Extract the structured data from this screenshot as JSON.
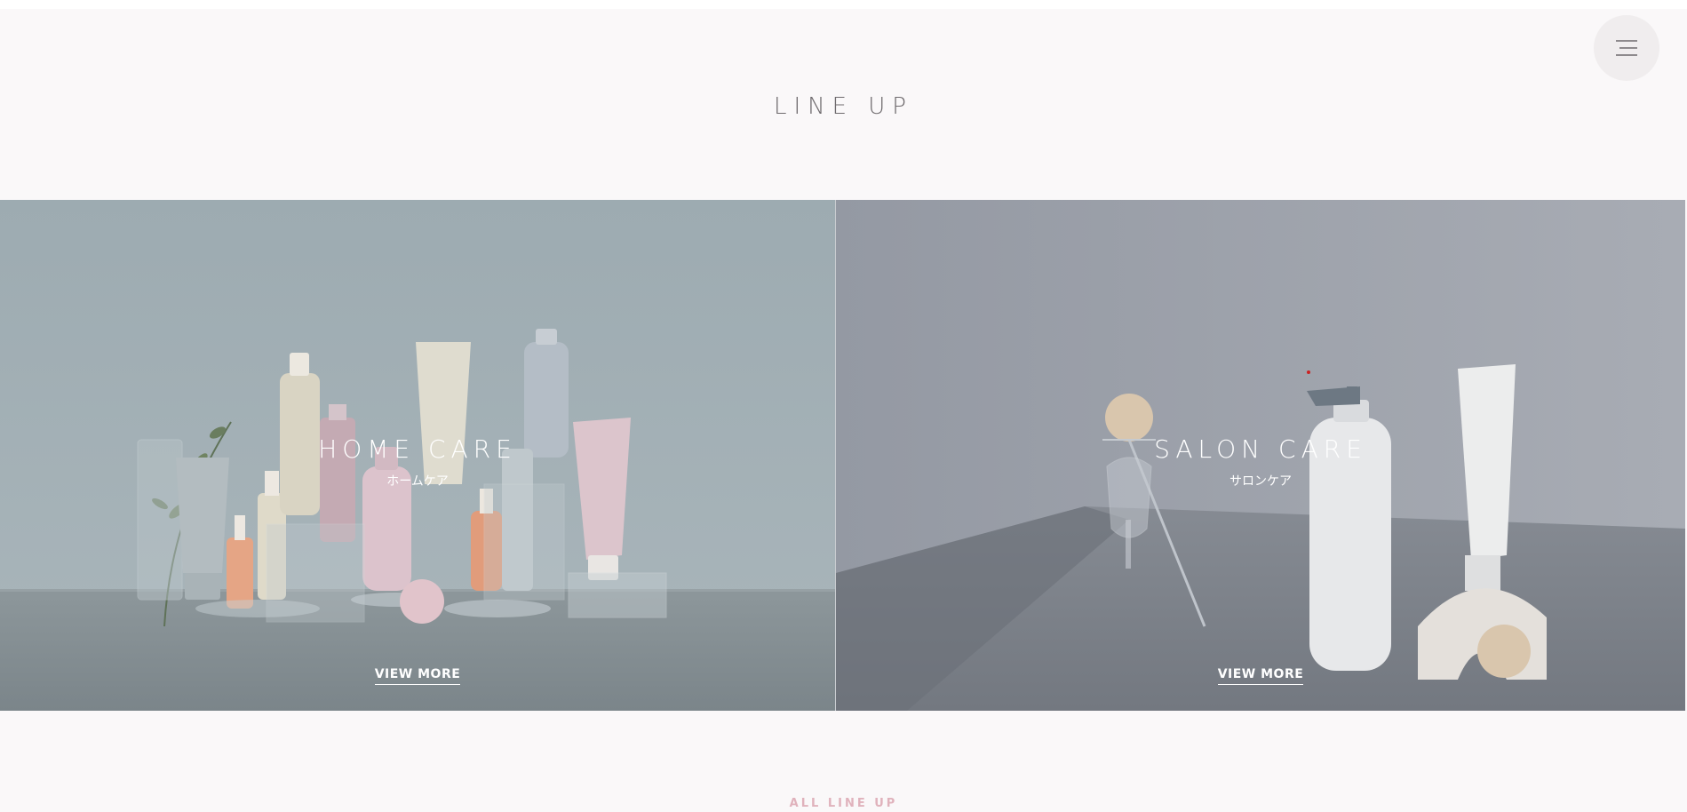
{
  "header": {
    "menu_icon": "hamburger-menu-icon"
  },
  "section": {
    "title": "LINE UP"
  },
  "panels": [
    {
      "title": "HOME CARE",
      "subtitle": "ホームケア",
      "link_label": "VIEW MORE",
      "overlay_color": "#9eabb2"
    },
    {
      "title": "SALON CARE",
      "subtitle": "サロンケア",
      "link_label": "VIEW MORE",
      "overlay_color": "#a4a8b0"
    }
  ],
  "footer": {
    "all_lineup_label": "ALL LINE UP",
    "accent_color": "#e0b2bc"
  }
}
